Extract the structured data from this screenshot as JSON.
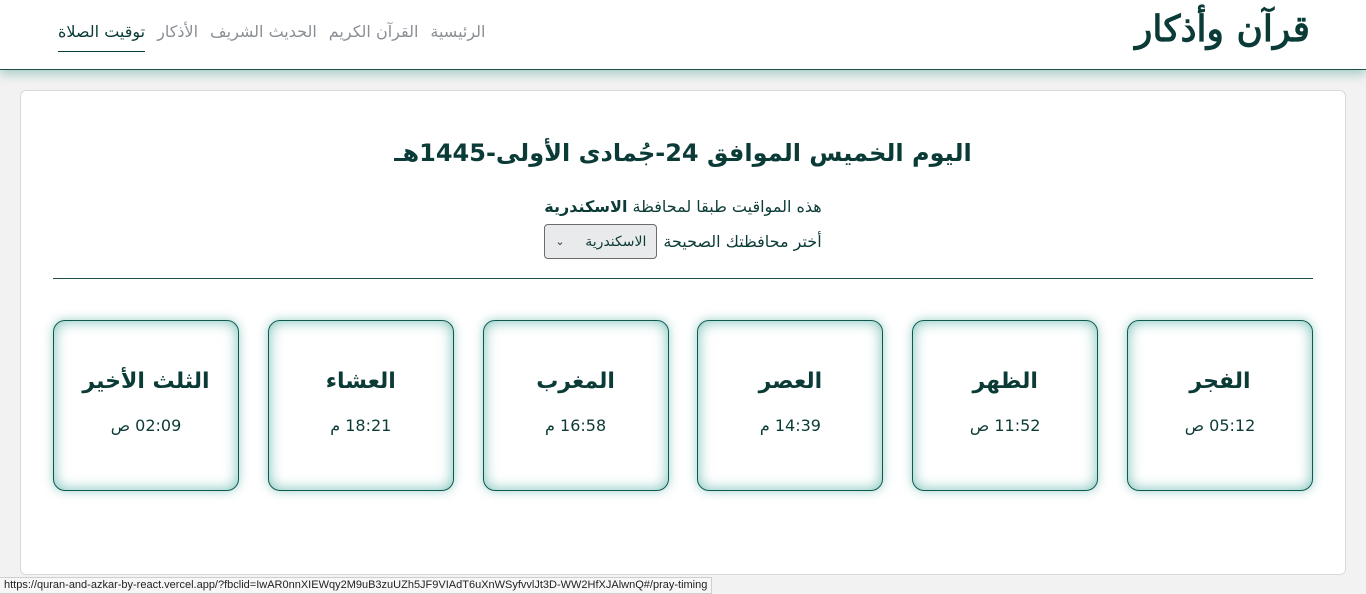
{
  "navbar": {
    "logo": "قرآن وأذكار",
    "links": [
      "توقيت الصلاة",
      "الأذكار",
      "الحديث الشريف",
      "القرآن الكريم",
      "الرئيسية"
    ],
    "active": "توقيت الصلاة"
  },
  "main": {
    "date_heading": "اليوم الخميس الموافق 24-جُمادى الأولى-1445هـ",
    "gov_prefix": "هذه المواقيت طبقا لمحافظة",
    "gov_name": "الاسكندرية",
    "select_label": "أختر محافظتك الصحيحة",
    "select_value": "الاسكندرية",
    "prayers": [
      {
        "name": "الفجر",
        "time": "05:12 ص"
      },
      {
        "name": "الظهر",
        "time": "11:52 ص"
      },
      {
        "name": "العصر",
        "time": "14:39 م"
      },
      {
        "name": "المغرب",
        "time": "16:58 م"
      },
      {
        "name": "العشاء",
        "time": "18:21 م"
      },
      {
        "name": "الثلث الأخير",
        "time": "02:09 ص"
      }
    ]
  },
  "status_bar": {
    "url": "https://quran-and-azkar-by-react.vercel.app/?fbclid=IwAR0nnXIEWqy2M9uB3zuUZh5JF9VIAdT6uXnWSyfvvlJt3D-WW2HfXJAlwnQ#/pray-timing"
  },
  "colors": {
    "primary": "#0b3b36",
    "nav_inactive": "#8a8f94",
    "glow": "#1e9687"
  }
}
